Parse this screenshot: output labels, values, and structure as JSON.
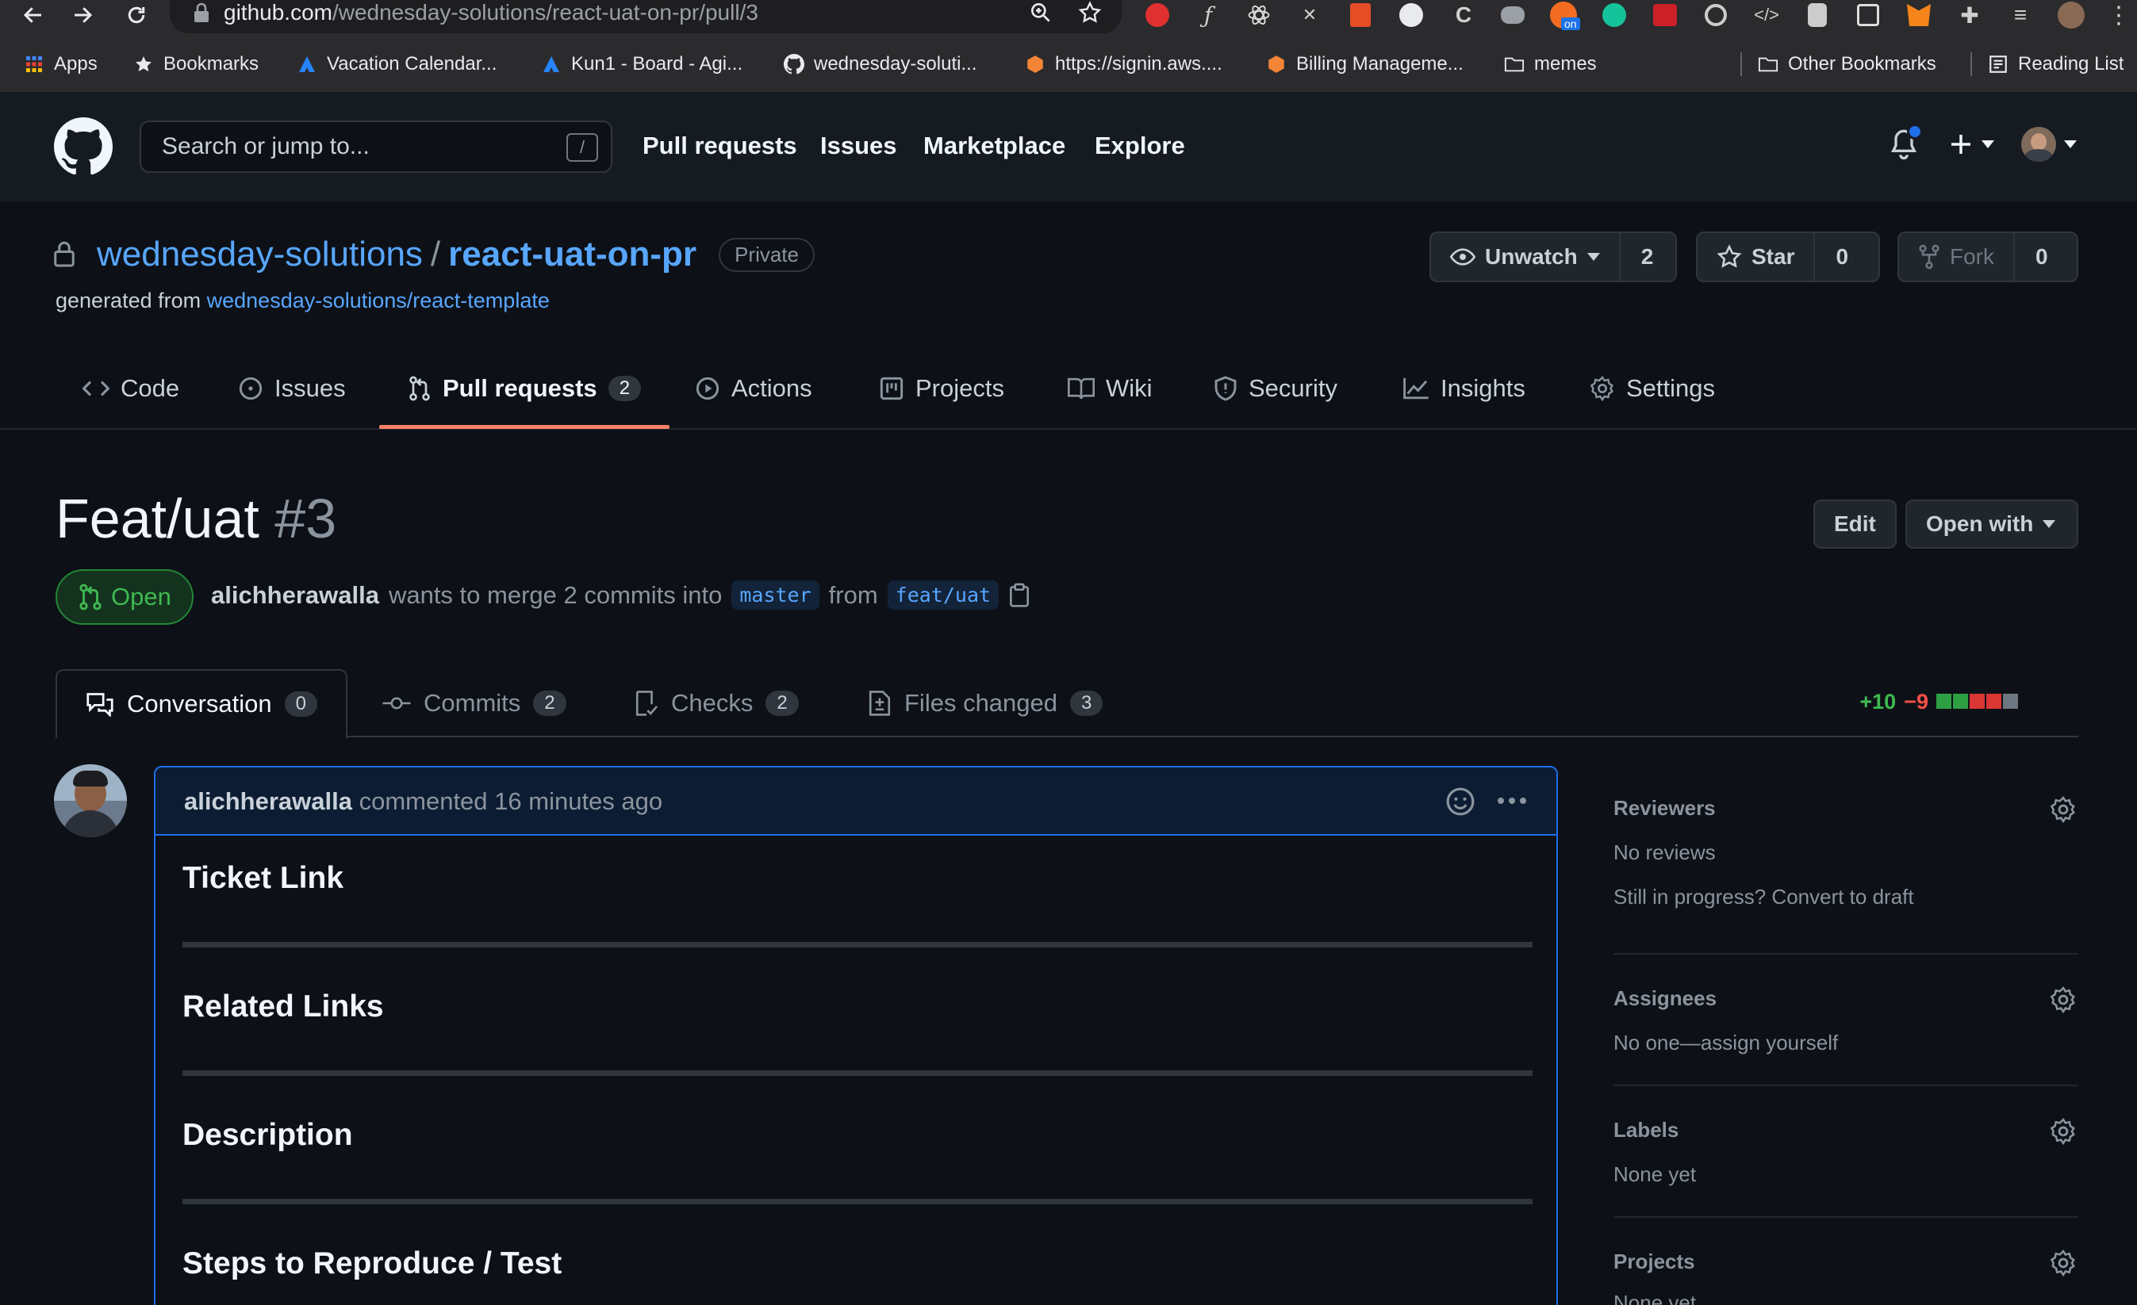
{
  "browser": {
    "url_host": "github.com",
    "url_path": "/wednesday-solutions/react-uat-on-pr/pull/3",
    "bookmarks": [
      {
        "label": "Apps",
        "icon": "apps-grid-icon"
      },
      {
        "label": "Bookmarks",
        "icon": "star-icon"
      },
      {
        "label": "Vacation Calendar...",
        "icon": "atlassian-icon"
      },
      {
        "label": "Kun1 - Board - Agi...",
        "icon": "atlassian-icon"
      },
      {
        "label": "wednesday-soluti...",
        "icon": "github-icon"
      },
      {
        "label": "https://signin.aws....",
        "icon": "aws-cube-icon"
      },
      {
        "label": "Billing Manageme...",
        "icon": "aws-cube-icon"
      },
      {
        "label": "memes",
        "icon": "folder-icon"
      },
      {
        "label": "Other Bookmarks",
        "icon": "folder-icon"
      },
      {
        "label": "Reading List",
        "icon": "reading-list-icon"
      }
    ],
    "extension_badge": "on"
  },
  "header": {
    "search_placeholder": "Search or jump to...",
    "search_shortcut": "/",
    "nav": [
      "Pull requests",
      "Issues",
      "Marketplace",
      "Explore"
    ]
  },
  "repo": {
    "owner": "wednesday-solutions",
    "separator": "/",
    "name": "react-uat-on-pr",
    "visibility": "Private",
    "generated_prefix": "generated from",
    "template": "wednesday-solutions/react-template",
    "watch": {
      "label": "Unwatch",
      "count": "2"
    },
    "star": {
      "label": "Star",
      "count": "0"
    },
    "fork": {
      "label": "Fork",
      "count": "0"
    },
    "tabs": [
      {
        "label": "Code"
      },
      {
        "label": "Issues"
      },
      {
        "label": "Pull requests",
        "count": "2"
      },
      {
        "label": "Actions"
      },
      {
        "label": "Projects"
      },
      {
        "label": "Wiki"
      },
      {
        "label": "Security"
      },
      {
        "label": "Insights"
      },
      {
        "label": "Settings"
      }
    ]
  },
  "pr": {
    "title": "Feat/uat",
    "number": "#3",
    "edit_label": "Edit",
    "open_with_label": "Open with",
    "state": "Open",
    "author": "alichherawalla",
    "merge_text": "wants to merge 2 commits into",
    "base_branch": "master",
    "from_text": "from",
    "head_branch": "feat/uat",
    "tabs": [
      {
        "label": "Conversation",
        "count": "0"
      },
      {
        "label": "Commits",
        "count": "2"
      },
      {
        "label": "Checks",
        "count": "2"
      },
      {
        "label": "Files changed",
        "count": "3"
      }
    ],
    "additions": "+10",
    "deletions": "−9",
    "diff_blocks": [
      "#2ea043",
      "#2ea043",
      "#da3633",
      "#da3633",
      "#6e7681"
    ]
  },
  "comment": {
    "author": "alichherawalla",
    "action_text": "commented 16 minutes ago",
    "headings": [
      "Ticket Link",
      "Related Links",
      "Description",
      "Steps to Reproduce / Test"
    ]
  },
  "sidebar": {
    "reviewers": {
      "title": "Reviewers",
      "value": "No reviews",
      "extra": "Still in progress? Convert to draft"
    },
    "assignees": {
      "title": "Assignees",
      "value": "No one—assign yourself"
    },
    "labels": {
      "title": "Labels",
      "value": "None yet"
    },
    "projects": {
      "title": "Projects",
      "value": "None yet"
    }
  },
  "colors": {
    "accent_link": "#58a6ff",
    "open_green": "#3fb950",
    "tab_underline": "#f78166",
    "comment_border": "#1f6feb"
  }
}
